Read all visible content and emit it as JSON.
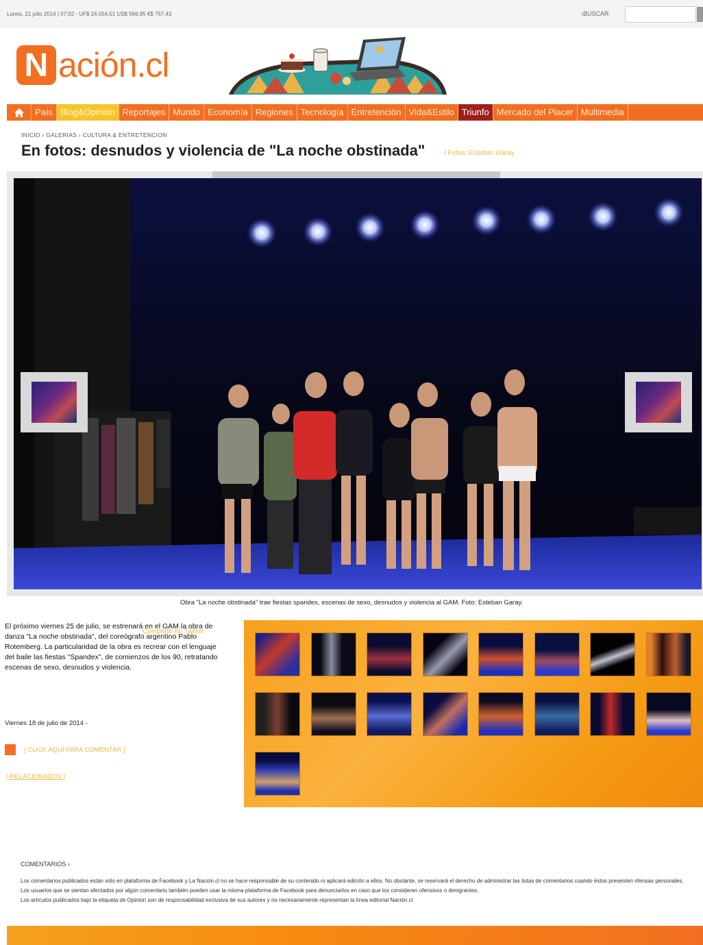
{
  "topbar": {
    "date_line": "Lunes, 21 julio 2014 | 07:02 - UF$ 24.054,51 US$ 566,95 €$ 767,43",
    "search_label": "›BUSCAR",
    "search_placeholder": ""
  },
  "header": {
    "logo_letter": "N",
    "logo_text": "ación.cl",
    "banner_icon": "cafe-laptop-illustration"
  },
  "nav": {
    "home_icon": "home-icon",
    "items": [
      "País",
      "Blog&Opinión",
      "Reportajes",
      "Mundo",
      "Economía",
      "Regiones",
      "Tecnología",
      "Entretención",
      "Vida&Estilo",
      "Triunfo",
      "Mercado del Placer",
      "Multimedia"
    ]
  },
  "breadcrumb": "INICIO › GALERIAS › CULTURA & ENTRETENCION",
  "title": "En fotos: desnudos y violencia de \"La noche obstinada\"",
  "photo_credit": "/ Fotos: Esteban Garay",
  "gallery": {
    "caption": "Obra \"La noche obstinada\" trae fiestas spandex, escenas de sexo, desnudos y violencia al GAM. Foto: Esteban Garay."
  },
  "article": {
    "text": "El próximo viernes 25 de julio, se estrenará en el GAM la obra de danza \"La noche obstinada\", del coreógrafo argentino Pablo Rotemberg. La particularidad de la obra es recrear con el lenguaje del baile las fiestas \"Spandex\", de comienzos de los 90, retratando escenas de sexo, desnudos y violencia.",
    "share": "Comparte en Twitter",
    "date": "Viernes 18 de julio de 2014 -",
    "comment_link": "[ CLICK AQUÍ PARA COMENTAR ]",
    "related": "[ RELACIONADOS ]"
  },
  "thumbnails_count": 17,
  "comments": {
    "title": "COMENTARIOS ›",
    "lines": [
      "Los comentarios publicados están sólo en plataforma de Facebook y La Nación.cl no se hace responsable de su contenido ni aplicará edición a ellos. No obstante, se reservará el derecho de administrar las listas de comentarios cuando éstos presenten ofensas personales.",
      "Los usuarios que se sientan afectados por algún comentario también pueden usar la misma plataforma de Facebook para denunciarlos en caso que los consideren ofensivos o denigrantes.",
      "Los artículos publicados bajo la etiqueta de Opinión son de responsabilidad exclusiva de sus autores y no necesariamente representan la línea editorial Nación.cl"
    ]
  },
  "colors": {
    "brand_orange": "#f26f21",
    "nav_yellow": "#f7c52b",
    "nav_red": "#a0201c",
    "link_gold": "#f5b63a"
  }
}
